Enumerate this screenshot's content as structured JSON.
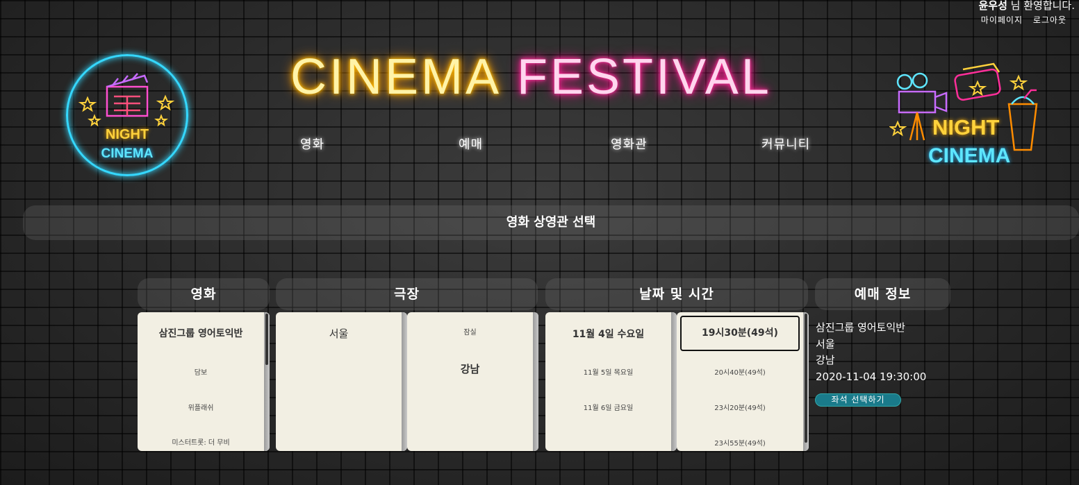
{
  "user": {
    "welcome_name": "윤우성",
    "welcome_suffix": " 님 환영합니다.",
    "mypage": "마이페이지",
    "logout": "로그아웃"
  },
  "header": {
    "title_part1": "CINEMA",
    "title_part2": "FESTIVAL",
    "logo_left_line1": "NIGHT",
    "logo_left_line2": "CINEMA",
    "logo_right_line1": "NIGHT",
    "logo_right_line2": "CINEMA"
  },
  "nav": {
    "items": [
      "영화",
      "예매",
      "영화관",
      "커뮤니티"
    ]
  },
  "page": {
    "section_title": "영화 상영관 선택"
  },
  "columns": {
    "movie": "영화",
    "theater": "극장",
    "datetime": "날짜 및 시간",
    "booking": "예매 정보"
  },
  "movies": [
    "삼진그룹 영어토익반",
    "담보",
    "위플래쉬",
    "미스터트롯: 더 무비"
  ],
  "regions": [
    "서울"
  ],
  "theaters": [
    "잠실",
    "강남"
  ],
  "dates": [
    "11월 4일 수요일",
    "11월 5일 목요일",
    "11월 6일 금요일"
  ],
  "times": [
    "19시30분(49석)",
    "20시40분(49석)",
    "23시20분(49석)",
    "23시55분(49석)"
  ],
  "booking_info": {
    "movie": "삼진그룹 영어토익반",
    "region": "서울",
    "theater": "강남",
    "datetime": "2020-11-04 19:30:00",
    "seat_button": "좌석 선택하기"
  },
  "colors": {
    "neon_yellow": "#ffd23c",
    "neon_pink": "#ff2f9a",
    "neon_cyan": "#35d8ff",
    "panel_bg": "#f2efe3",
    "button_teal": "#1a7b8b"
  }
}
